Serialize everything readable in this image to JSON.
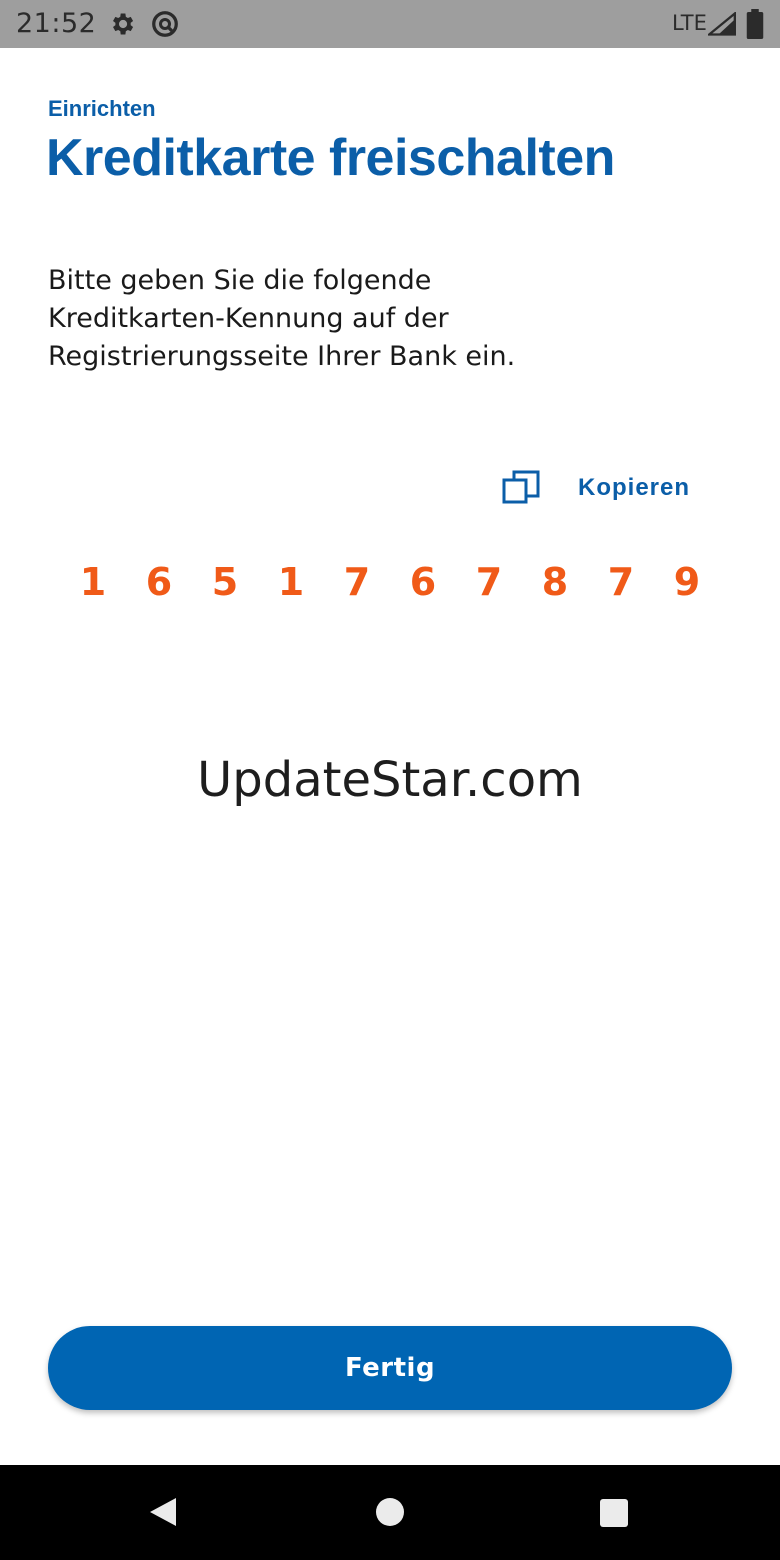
{
  "status_bar": {
    "time": "21:52",
    "network": "LTE",
    "icons": [
      "gear-icon",
      "sync-icon",
      "signal-icon",
      "battery-icon"
    ]
  },
  "header": {
    "eyebrow": "Einrichten",
    "title": "Kreditkarte freischalten"
  },
  "instruction": "Bitte geben Sie die folgende Kreditkarten-Kennung auf der Registrierungsseite Ihrer Bank ein.",
  "copy": {
    "label": "Kopieren",
    "icon": "copy-icon"
  },
  "card_id_digits": [
    "1",
    "6",
    "5",
    "1",
    "7",
    "6",
    "7",
    "8",
    "7",
    "9"
  ],
  "watermark": "UpdateStar.com",
  "done_button": {
    "label": "Fertig"
  },
  "nav_bar": {
    "icons": [
      "back-icon",
      "home-icon",
      "recents-icon"
    ]
  },
  "colors": {
    "brand_blue": "#0b5ea8",
    "button_blue": "#0065b3",
    "digit_orange": "#f05a18",
    "status_bar_gray": "#9e9e9e"
  }
}
